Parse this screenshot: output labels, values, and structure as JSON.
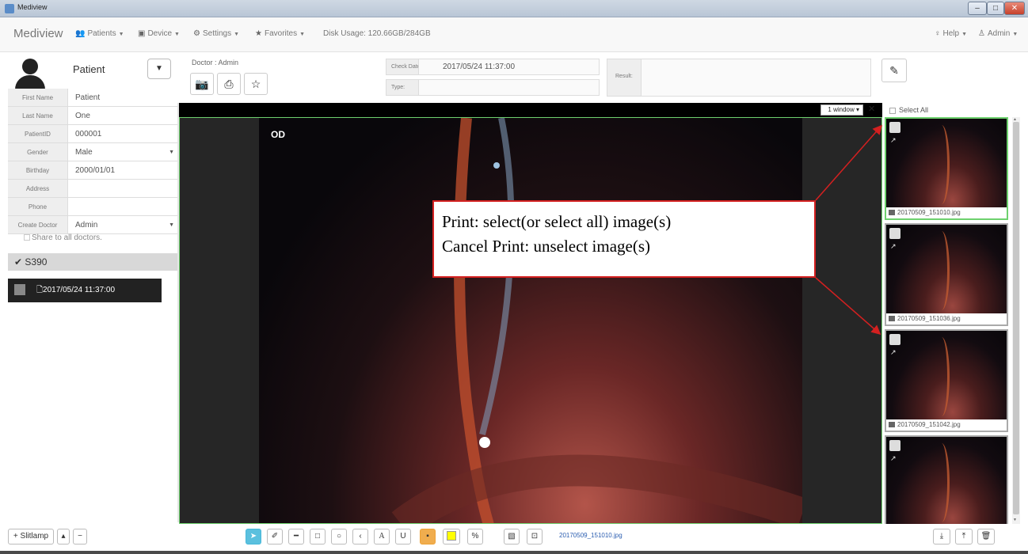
{
  "window": {
    "title": "Mediview"
  },
  "navbar": {
    "brand": "Mediview",
    "items": [
      {
        "label": "Patients",
        "icon": "users-icon"
      },
      {
        "label": "Device",
        "icon": "device-icon"
      },
      {
        "label": "Settings",
        "icon": "gears-icon"
      },
      {
        "label": "Favorites",
        "icon": "star-icon"
      }
    ],
    "disk_usage": "Disk Usage: 120.66GB/284GB",
    "help": "Help",
    "admin": "Admin"
  },
  "patient": {
    "header": "Patient",
    "fields": [
      {
        "label": "First Name",
        "value": "Patient",
        "dropdown": false
      },
      {
        "label": "Last Name",
        "value": "One",
        "dropdown": false
      },
      {
        "label": "PatientID",
        "value": "000001",
        "dropdown": false
      },
      {
        "label": "Gender",
        "value": "Male",
        "dropdown": true
      },
      {
        "label": "Birthday",
        "value": "2000/01/01",
        "dropdown": false
      },
      {
        "label": "Address",
        "value": "",
        "dropdown": false
      },
      {
        "label": "Phone",
        "value": "",
        "dropdown": false
      },
      {
        "label": "Create Doctor",
        "value": "Admin",
        "dropdown": true
      }
    ],
    "share": "Share to all doctors."
  },
  "device_group": {
    "name": "S390"
  },
  "record": {
    "date": "2017/05/24 11:37:00"
  },
  "exam": {
    "doctor": "Doctor : Admin",
    "check_date_label": "Check Date:",
    "check_date": "2017/05/24 11:37:00",
    "type_label": "Type:",
    "type": "",
    "result_label": "Result:",
    "result": ""
  },
  "viewer": {
    "window_mode": "1 window",
    "eye_label": "OD"
  },
  "annotation": {
    "line1": "Print: select(or select all) image(s)",
    "line2": "Cancel Print: unselect image(s)",
    "color": "#d42020"
  },
  "thumbnails": {
    "select_all": "Select All",
    "items": [
      {
        "name": "20170509_151010.jpg",
        "selected": true
      },
      {
        "name": "20170509_151036.jpg",
        "selected": false
      },
      {
        "name": "20170509_151042.jpg",
        "selected": false
      },
      {
        "name": "",
        "selected": false
      }
    ]
  },
  "bottom": {
    "add_device": "+ Slitlamp",
    "current_file": "20170509_151010.jpg"
  },
  "colors": {
    "selected_border": "#6ed16e",
    "tool_active": "#5bc0de",
    "highlight_swatch": "#ffff00"
  }
}
